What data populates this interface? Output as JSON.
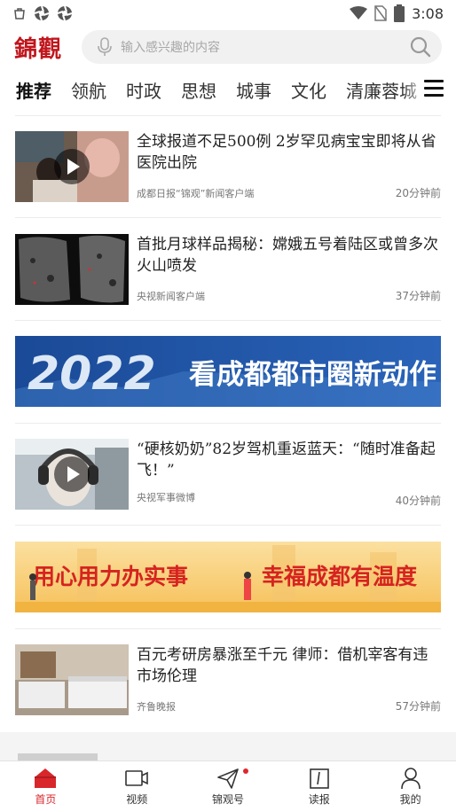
{
  "status_bar": {
    "time": "3:08"
  },
  "header": {
    "logo": "錦觀",
    "search_placeholder": "输入感兴趣的内容"
  },
  "tabs": [
    "推荐",
    "领航",
    "时政",
    "思想",
    "城事",
    "文化",
    "清廉蓉城"
  ],
  "news": [
    {
      "title": "全球报道不足500例 2岁罕见病宝宝即将从省医院出院",
      "source": "成都日报“锦观”新闻客户端",
      "time": "20分钟前",
      "video": true
    },
    {
      "title": "首批月球样品揭秘：嫦娥五号着陆区或曾多次火山喷发",
      "source": "央视新闻客户端",
      "time": "37分钟前",
      "video": false
    },
    {
      "title": "“硬核奶奶”82岁驾机重返蓝天：“随时准备起飞！”",
      "source": "央视军事微博",
      "time": "40分钟前",
      "video": true
    },
    {
      "title": "百元考研房暴涨至千元 律师：借机宰客有违市场伦理",
      "source": "齐鲁晚报",
      "time": "57分钟前",
      "video": false
    }
  ],
  "banners": [
    {
      "year": "2022",
      "text": "看成都都市圈新动作"
    },
    {
      "left": "用心用力办实事",
      "right": "幸福成都有温度"
    }
  ],
  "bottom_nav": [
    {
      "label": "首页",
      "icon": "home-icon",
      "active": true
    },
    {
      "label": "视频",
      "icon": "video-icon",
      "active": false
    },
    {
      "label": "锦观号",
      "icon": "paper-plane-icon",
      "active": false,
      "badge": true
    },
    {
      "label": "读报",
      "icon": "newspaper-icon",
      "active": false
    },
    {
      "label": "我的",
      "icon": "user-icon",
      "active": false
    }
  ],
  "colors": {
    "brand": "#c0161c",
    "accent": "#d8262b",
    "banner_blue": "#1d4f9c",
    "banner_red": "#d6231f"
  }
}
